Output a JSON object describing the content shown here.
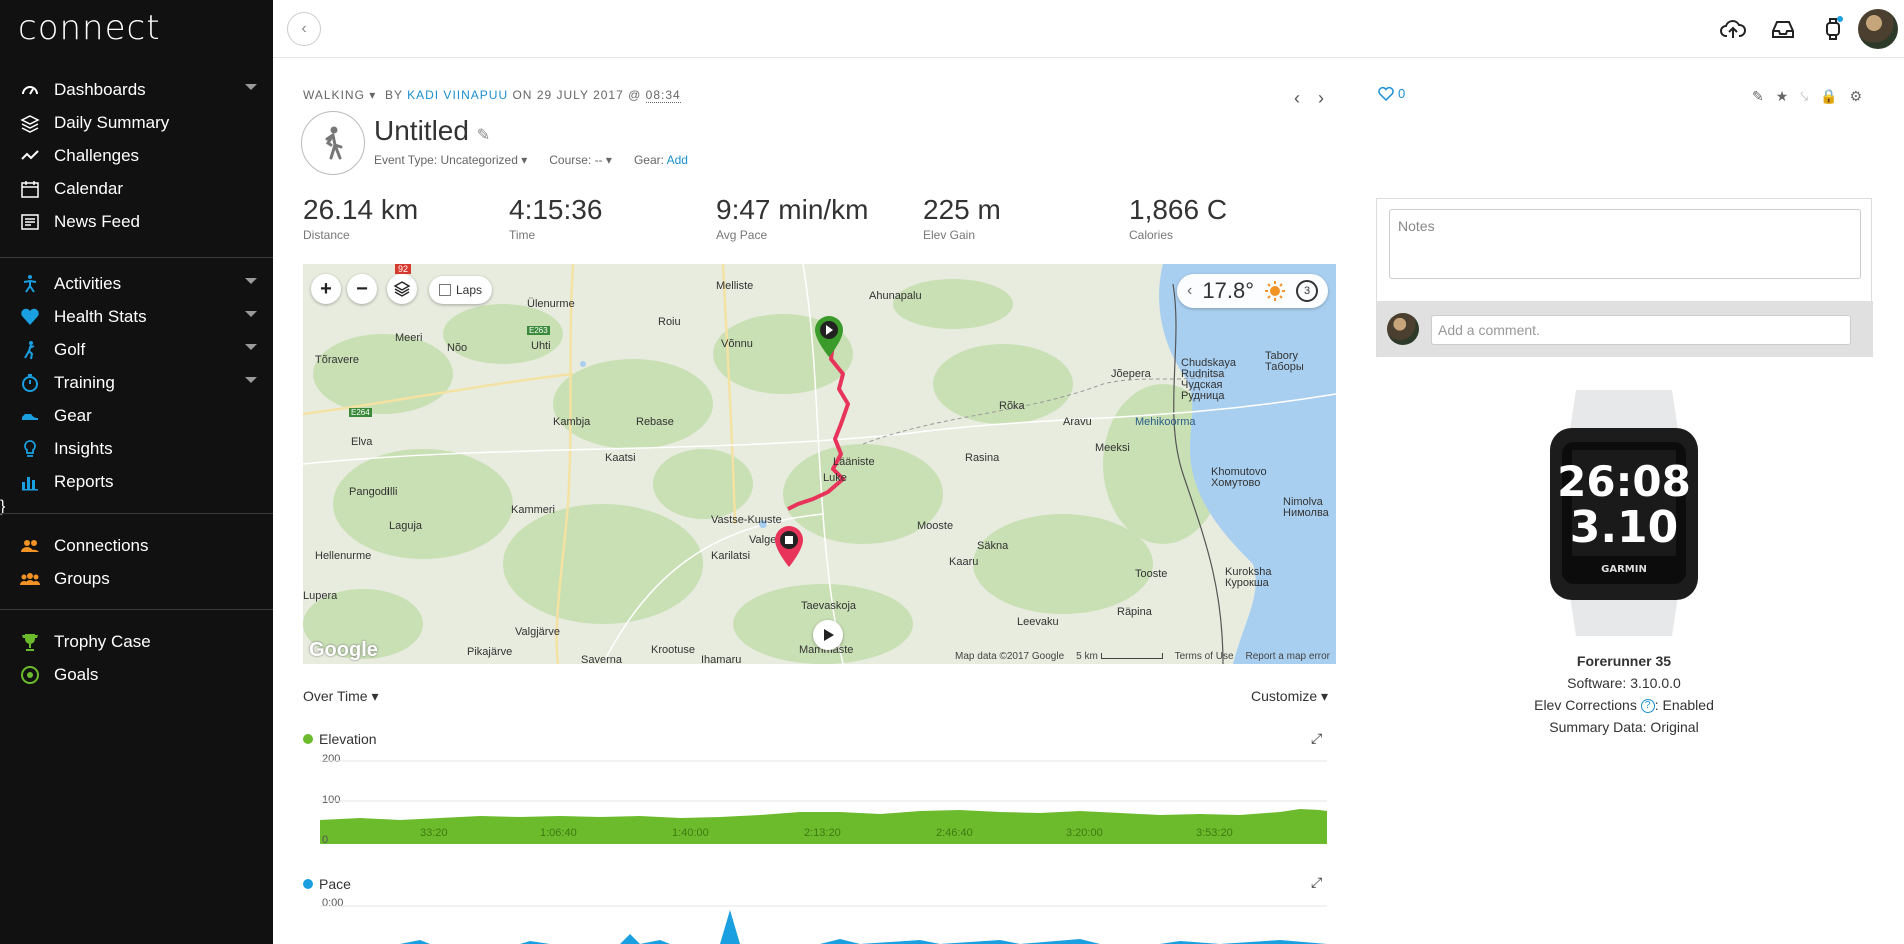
{
  "app": {
    "logo": "connect"
  },
  "sidebar": {
    "group1": [
      {
        "label": "Dashboards",
        "icon": "dashboard-icon",
        "has_caret": true
      },
      {
        "label": "Daily Summary",
        "icon": "layers-icon",
        "has_caret": false
      },
      {
        "label": "Challenges",
        "icon": "challenges-icon",
        "has_caret": false
      },
      {
        "label": "Calendar",
        "icon": "calendar-icon",
        "has_caret": false
      },
      {
        "label": "News Feed",
        "icon": "newsfeed-icon",
        "has_caret": false
      }
    ],
    "group2": [
      {
        "label": "Activities",
        "icon": "activities-icon",
        "has_caret": true
      },
      {
        "label": "Health Stats",
        "icon": "heart-icon",
        "has_caret": true
      },
      {
        "label": "Golf",
        "icon": "golf-icon",
        "has_caret": true
      },
      {
        "label": "Training",
        "icon": "training-icon",
        "has_caret": true
      },
      {
        "label": "Gear",
        "icon": "shoe-icon",
        "has_caret": false
      },
      {
        "label": "Insights",
        "icon": "lightbulb-icon",
        "has_caret": false
      },
      {
        "label": "Reports",
        "icon": "reports-icon",
        "has_caret": false
      }
    ],
    "group3": [
      {
        "label": "Connections",
        "icon": "connections-icon",
        "has_caret": false
      },
      {
        "label": "Groups",
        "icon": "groups-icon",
        "has_caret": false
      }
    ],
    "group4": [
      {
        "label": "Trophy Case",
        "icon": "trophy-icon",
        "has_caret": false
      },
      {
        "label": "Goals",
        "icon": "goals-icon",
        "has_caret": false
      }
    ]
  },
  "activity": {
    "type": "WALKING",
    "by": "BY",
    "author": "KADI VIINAPUU",
    "on": "ON",
    "date": "29 JULY 2017",
    "at": "@",
    "time": "08:34",
    "title": "Untitled",
    "event_type": "Event Type: Uncategorized",
    "course": "Course: --",
    "gear_label": "Gear:",
    "gear_action": "Add",
    "likes": "0"
  },
  "stats": [
    {
      "value": "26.14 km",
      "label": "Distance"
    },
    {
      "value": "4:15:36",
      "label": "Time"
    },
    {
      "value": "9:47 min/km",
      "label": "Avg Pace"
    },
    {
      "value": "225 m",
      "label": "Elev Gain"
    },
    {
      "value": "1,866 C",
      "label": "Calories"
    }
  ],
  "map": {
    "laps_label": "Laps",
    "temperature": "17.8°",
    "weather_badge": "3",
    "road_badge": "92",
    "footer": {
      "data": "Map data ©2017 Google",
      "scale": "5 km",
      "terms": "Terms of Use",
      "report": "Report a map error"
    },
    "google": "Google",
    "places": [
      "Melliste",
      "Ahunapalu",
      "Ülenurme",
      "Roiu",
      "Võnnu",
      "Meeri",
      "Nõo",
      "Uhti",
      "Tõravere",
      "E263",
      "E264",
      "Elva",
      "Kambja",
      "Rebase",
      "Kaatsi",
      "Rõka",
      "Aravu",
      "Mehikoorma",
      "Jõepera",
      "Chudskaya Rudnitsa",
      "Чудская Рудница",
      "Tabory",
      "Таборы",
      "Rasina",
      "Meeksi",
      "Pangodi",
      "Kammeri",
      "Illi",
      "Laguja",
      "Vastse-Kuuste",
      "Valgesoo",
      "Mooste",
      "Luke",
      "Lääniste",
      "Hellenurme",
      "Karilatsi",
      "Kaaru",
      "Säkna",
      "Tooste",
      "Khomutovo",
      "Хомутово",
      "Nimolva",
      "Нимолва",
      "Kuroksha",
      "Курокша",
      "Taevaskoja",
      "Leevaku",
      "Räpina",
      "Lupera",
      "Valgjärve",
      "Pikajärve",
      "Krootuse",
      "Saverna",
      "Ihamaru",
      "Mammaste"
    ]
  },
  "charts": {
    "view_label": "Over Time",
    "customize_label": "Customize",
    "elevation": {
      "title": "Elevation",
      "color": "#6cbb2d",
      "y_ticks": [
        "200",
        "100",
        "0"
      ],
      "x_ticks": [
        "33:20",
        "1:06:40",
        "1:40:00",
        "2:13:20",
        "2:46:40",
        "3:20:00",
        "3:53:20"
      ]
    },
    "pace": {
      "title": "Pace",
      "color": "#1a9fe0",
      "y_ticks": [
        "0:00"
      ]
    }
  },
  "notes": {
    "placeholder": "Notes",
    "comment_placeholder": "Add a comment."
  },
  "device": {
    "name": "Forerunner 35",
    "software": "Software: 3.10.0.0",
    "elev_corrections_label": "Elev Corrections",
    "elev_corrections_value": ": Enabled",
    "summary_data": "Summary Data: Original",
    "watch_time": "26:08",
    "watch_dist": "3.10",
    "watch_brand": "GARMIN"
  }
}
